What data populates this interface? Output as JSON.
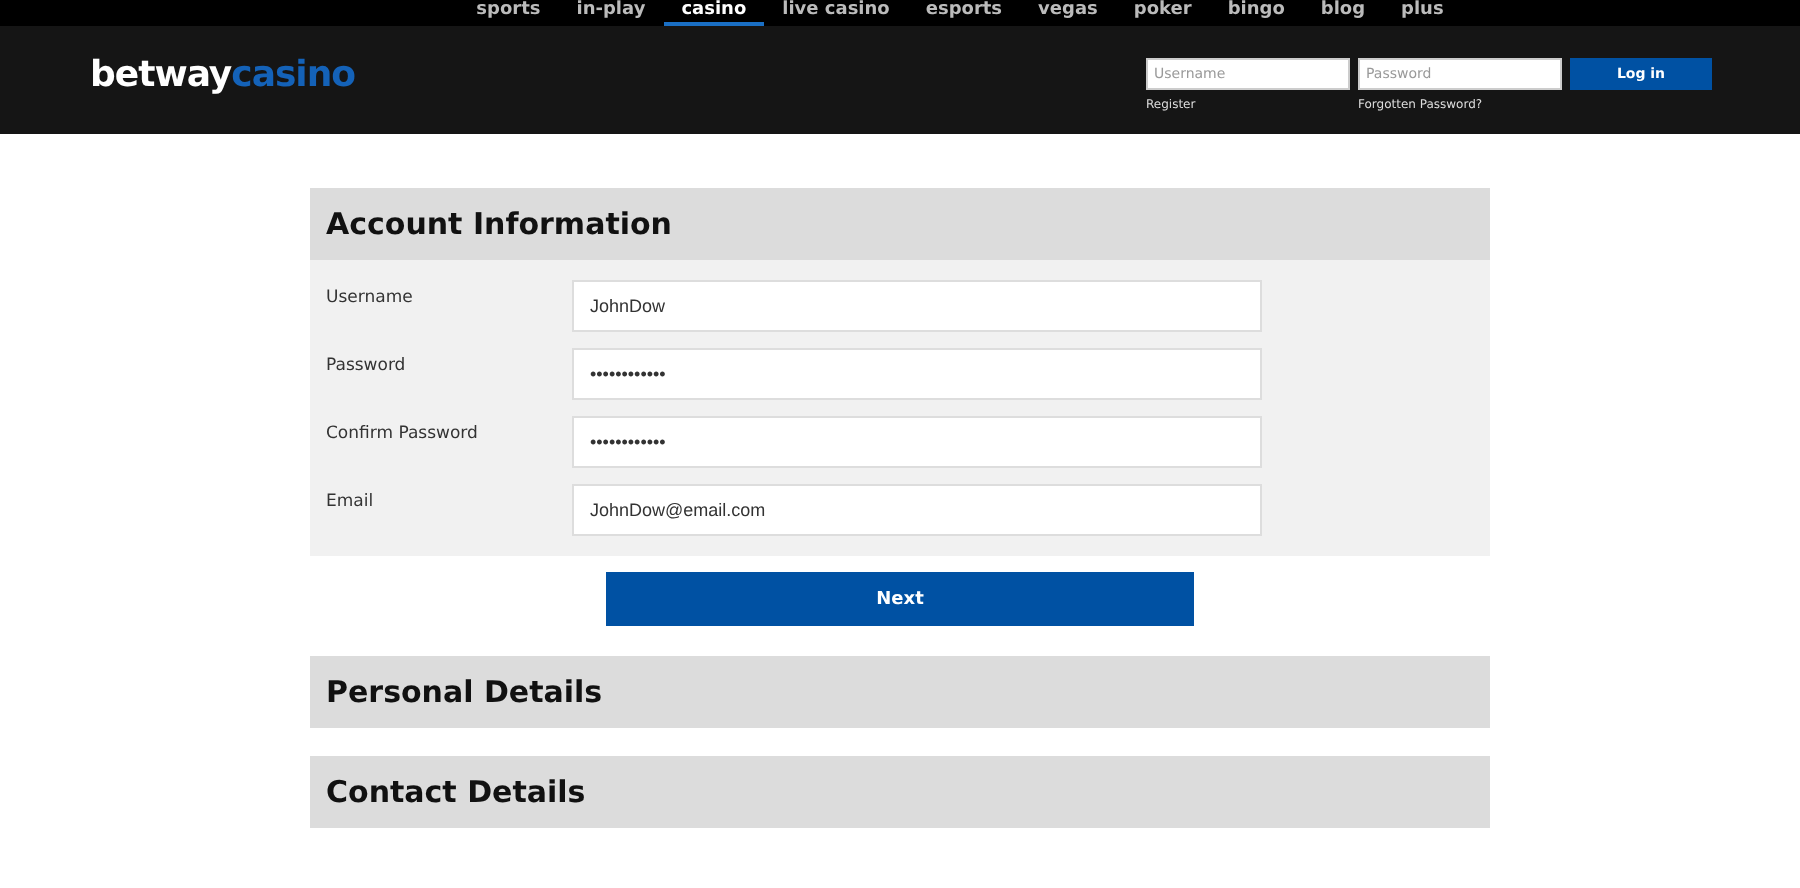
{
  "nav": [
    {
      "label": "sports",
      "selected": false
    },
    {
      "label": "in-play",
      "selected": false
    },
    {
      "label": "casino",
      "selected": true
    },
    {
      "label": "live casino",
      "selected": false
    },
    {
      "label": "esports",
      "selected": false
    },
    {
      "label": "vegas",
      "selected": false
    },
    {
      "label": "poker",
      "selected": false
    },
    {
      "label": "bingo",
      "selected": false
    },
    {
      "label": "blog",
      "selected": false
    },
    {
      "label": "plus",
      "selected": false
    }
  ],
  "logo": {
    "brand": "betway",
    "product": "casino"
  },
  "login": {
    "username_placeholder": "Username",
    "password_placeholder": "Password",
    "button": "Log in",
    "register": "Register",
    "forgotten": "Forgotten Password?"
  },
  "sections": [
    {
      "title": "Account Information",
      "expanded": true,
      "fields": [
        {
          "label": "Username",
          "value": "JohnDow"
        },
        {
          "label": "Password",
          "value": "••••••••••••"
        },
        {
          "label": "Confirm Password",
          "value": "••••••••••••"
        },
        {
          "label": "Email",
          "value": "JohnDow@email.com"
        }
      ],
      "button": "Next"
    },
    {
      "title": "Personal Details",
      "expanded": false
    },
    {
      "title": "Contact Details",
      "expanded": false
    }
  ]
}
